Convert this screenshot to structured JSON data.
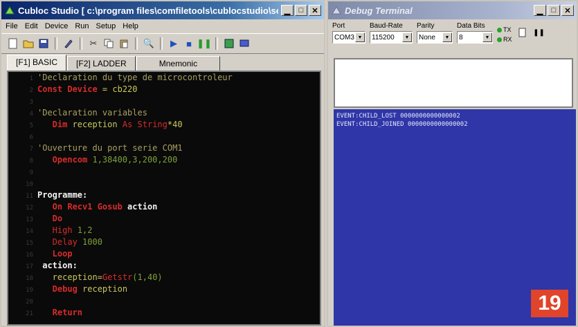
{
  "studio": {
    "title": "Cubloc Studio  [ c:\\program files\\comfiletools\\cublocstudio\\se...",
    "menu": [
      "File",
      "Edit",
      "Device",
      "Run",
      "Setup",
      "Help"
    ],
    "tabs": [
      "[F1] BASIC",
      "[F2] LADDER",
      "Mnemonic"
    ],
    "code": [
      {
        "n": "1",
        "parts": [
          {
            "t": "'Declaration du type de microcontroleur",
            "c": "c-comment"
          }
        ]
      },
      {
        "n": "2",
        "parts": [
          {
            "t": "Const Device",
            "c": "c-kw"
          },
          {
            "t": " = cb220",
            "c": "c-plain"
          }
        ]
      },
      {
        "n": "3",
        "parts": []
      },
      {
        "n": "4",
        "parts": [
          {
            "t": "'Declaration variables",
            "c": "c-comment"
          }
        ]
      },
      {
        "n": "5",
        "parts": [
          {
            "t": "   Dim",
            "c": "c-kw"
          },
          {
            "t": " reception ",
            "c": "c-plain"
          },
          {
            "t": "As String",
            "c": "c-kw2"
          },
          {
            "t": "*40",
            "c": "c-plain"
          }
        ]
      },
      {
        "n": "6",
        "parts": []
      },
      {
        "n": "7",
        "parts": [
          {
            "t": "'Ouverture du port serie COM1",
            "c": "c-comment"
          }
        ]
      },
      {
        "n": "8",
        "parts": [
          {
            "t": "   Opencom",
            "c": "c-kw"
          },
          {
            "t": " 1,38400,3,200,200",
            "c": "c-num"
          }
        ]
      },
      {
        "n": "9",
        "parts": []
      },
      {
        "n": "10",
        "parts": []
      },
      {
        "n": "11",
        "parts": [
          {
            "t": "Programme:",
            "c": "c-label"
          }
        ]
      },
      {
        "n": "12",
        "parts": [
          {
            "t": "   On Recv1 Gosub",
            "c": "c-kw"
          },
          {
            "t": " action",
            "c": "c-white"
          }
        ]
      },
      {
        "n": "13",
        "parts": [
          {
            "t": "   Do",
            "c": "c-kw"
          }
        ]
      },
      {
        "n": "14",
        "parts": [
          {
            "t": "   High",
            "c": "c-kw2"
          },
          {
            "t": " 1,2",
            "c": "c-num"
          }
        ]
      },
      {
        "n": "15",
        "parts": [
          {
            "t": "   Delay",
            "c": "c-kw2"
          },
          {
            "t": " 1000",
            "c": "c-num"
          }
        ]
      },
      {
        "n": "16",
        "parts": [
          {
            "t": "   Loop",
            "c": "c-kw"
          }
        ]
      },
      {
        "n": "17",
        "parts": [
          {
            "t": " action:",
            "c": "c-label"
          }
        ]
      },
      {
        "n": "18",
        "parts": [
          {
            "t": "   reception",
            "c": "c-plain"
          },
          {
            "t": "=",
            "c": "c-plain"
          },
          {
            "t": "Getstr",
            "c": "c-kw2"
          },
          {
            "t": "(1,40)",
            "c": "c-num"
          }
        ]
      },
      {
        "n": "19",
        "parts": [
          {
            "t": "   Debug",
            "c": "c-kw"
          },
          {
            "t": " reception",
            "c": "c-plain"
          }
        ]
      },
      {
        "n": "20",
        "parts": []
      },
      {
        "n": "21",
        "parts": [
          {
            "t": "   Return",
            "c": "c-kw"
          }
        ]
      }
    ]
  },
  "terminal": {
    "title": "Debug Terminal",
    "port_label": "Port",
    "port_value": "COM3",
    "baud_label": "Baud-Rate",
    "baud_value": "115200",
    "parity_label": "Parity",
    "parity_value": "None",
    "databits_label": "Data Bits",
    "databits_value": "8",
    "tx_label": "TX",
    "rx_label": "RX",
    "received": [
      "EVENT:CHILD_LOST 0000000000000002",
      "EVENT:CHILD_JOINED 0000000000000002"
    ]
  },
  "badge": "19",
  "colors": {
    "editor_bg": "#0a0a0a",
    "terminal_bg": "#2e36a8",
    "badge": "#e0442a",
    "led": "#2aa02a"
  }
}
